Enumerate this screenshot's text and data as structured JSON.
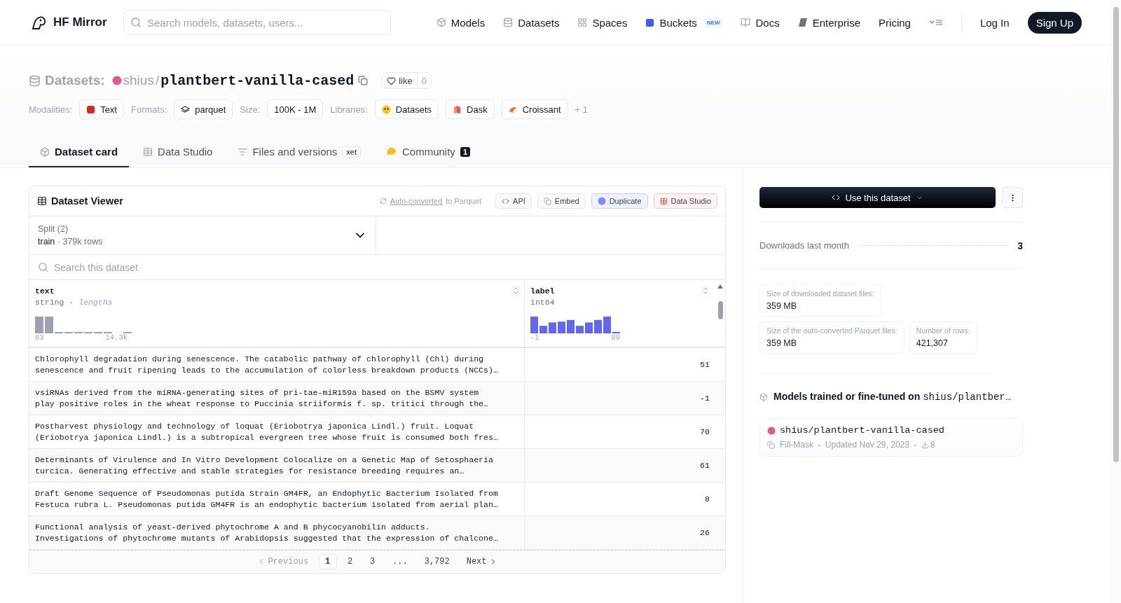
{
  "nav": {
    "brand": "HF Mirror",
    "search": {
      "placeholder": "Search models, datasets, users..."
    },
    "links": [
      {
        "kind": "models",
        "label": "Models"
      },
      {
        "kind": "datasets",
        "label": "Datasets"
      },
      {
        "kind": "spaces",
        "label": "Spaces"
      },
      {
        "kind": "buckets",
        "label": "Buckets",
        "badge": "NEW"
      },
      {
        "kind": "docs",
        "label": "Docs"
      },
      {
        "kind": "enterprise",
        "label": "Enterprise"
      },
      {
        "kind": "plain",
        "label": "Pricing"
      }
    ],
    "login": "Log In",
    "signup": "Sign Up"
  },
  "header": {
    "category": "Datasets:",
    "owner": "shius",
    "separator": "/",
    "name": "plantbert-vanilla-cased",
    "like": "like",
    "like_count": "0",
    "facets": [
      {
        "label": "Modalities:",
        "tags": [
          {
            "kind": "text",
            "label": "Text"
          }
        ]
      },
      {
        "label": "Formats:",
        "tags": [
          {
            "kind": "parquet",
            "label": "parquet"
          }
        ]
      },
      {
        "label": "Size:",
        "tags": [
          {
            "kind": "plain",
            "label": "100K - 1M"
          }
        ]
      },
      {
        "label": "Libraries:",
        "tags": [
          {
            "kind": "datasets",
            "label": "Datasets"
          },
          {
            "kind": "dask",
            "label": "Dask"
          },
          {
            "kind": "croissant",
            "label": "Croissant"
          }
        ],
        "more": "+ 1"
      }
    ]
  },
  "tabs": [
    {
      "kind": "card",
      "label": "Dataset card",
      "selected": true
    },
    {
      "kind": "studio",
      "label": "Data Studio",
      "selected": false
    },
    {
      "kind": "files",
      "label": "Files and versions",
      "badge": "xet",
      "selected": false
    },
    {
      "kind": "community",
      "label": "Community",
      "count": "1",
      "selected": false
    }
  ],
  "viewer": {
    "title": "Dataset Viewer",
    "converted_link": "Auto-converted",
    "converted_rest": "to Parquet",
    "actions": [
      {
        "kind": "api",
        "label": "API"
      },
      {
        "kind": "embed",
        "label": "Embed"
      },
      {
        "kind": "duplicate",
        "label": "Duplicate"
      },
      {
        "kind": "studio",
        "label": "Data Studio"
      }
    ],
    "split": {
      "label": "Split (2)",
      "value": "train",
      "dot": "·",
      "rows": "379k rows"
    },
    "search": {
      "placeholder": "Search this dataset"
    },
    "columns": [
      {
        "kind": "string",
        "name": "text",
        "type": "string",
        "dot": "·",
        "extra": "lengths",
        "min": "63",
        "max": "14.3k"
      },
      {
        "kind": "int",
        "name": "label",
        "type": "int64",
        "min": "-1",
        "max": "89"
      }
    ],
    "rows": [
      {
        "text": "Chlorophyll degradation during senescence. The catabolic pathway of chlorophyll (Chl) during\nsenescence and fruit ripening leads to the accumulation of colorless breakdown products (NCCs)…",
        "label": "51"
      },
      {
        "text": "vsiRNAs derived from the miRNA-generating sites of pri-tae-miR159a based on the BSMV system\nplay positive roles in the wheat response to Puccinia striiformis f. sp. tritici through the…",
        "label": "-1"
      },
      {
        "text": "Postharvest physiology and technology of loquat (Eriobotrya japonica Lindl.) fruit. Loquat\n(Eriobotrya japonica Lindl.) is a subtropical evergreen tree whose fruit is consumed both fres…",
        "label": "70"
      },
      {
        "text": "Determinants of Virulence and In Vitro Development Colocalize on a Genetic Map of Setosphaeria\nturcica. Generating effective and stable strategies for resistance breeding requires an…",
        "label": "61"
      },
      {
        "text": "Draft Genome Sequence of Pseudomonas putida Strain GM4FR, an Endophytic Bacterium Isolated from\nFestuca rubra L. Pseudomonas putida GM4FR is an endophytic bacterium isolated from aerial plan…",
        "label": "8"
      },
      {
        "text": "Functional analysis of yeast-derived phytochrome A and B phycocyanobilin adducts.\nInvestigations of phytochrome mutants of Arabidopsis suggested that the expression of chalcone…",
        "label": "26"
      }
    ],
    "pagination": {
      "previous": "Previous",
      "pages": [
        {
          "label": "1",
          "selected": true
        },
        {
          "label": "2",
          "selected": false
        },
        {
          "label": "3",
          "selected": false
        },
        {
          "label": "...",
          "selected": false
        },
        {
          "label": "3,792",
          "selected": false
        }
      ],
      "next": "Next"
    }
  },
  "sidebar": {
    "use_button": "Use this dataset",
    "downloads": {
      "label": "Downloads last month",
      "value": "3"
    },
    "stats": [
      {
        "label": "Size of downloaded dataset files:",
        "value": "359 MB"
      },
      {
        "label": "Size of the auto-converted Parquet files:",
        "value": "359 MB"
      },
      {
        "label": "Number of rows:",
        "value": "421,307"
      }
    ],
    "models": {
      "title": "Models trained or fine-tuned on",
      "repo": "shius/plantber…",
      "items": [
        {
          "name": "shius/plantbert-vanilla-cased",
          "task": "Fill-Mask",
          "dot": "•",
          "updated": "Updated Nov 29, 2023",
          "dot_2": "•",
          "downloads": "8"
        }
      ]
    }
  }
}
